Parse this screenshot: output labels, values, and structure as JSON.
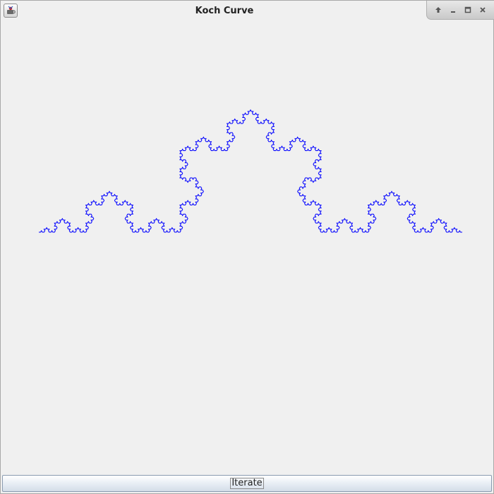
{
  "window": {
    "title": "Koch Curve"
  },
  "title_controls": {
    "icons": [
      "shade-up-icon",
      "minimize-icon",
      "maximize-icon",
      "close-icon"
    ]
  },
  "canvas": {
    "fractal": "koch-curve",
    "iterations": 5,
    "stroke_color": "#0000ff",
    "background_color": "#f0f0f0"
  },
  "toolbar": {
    "iterate_label": "Iterate"
  }
}
